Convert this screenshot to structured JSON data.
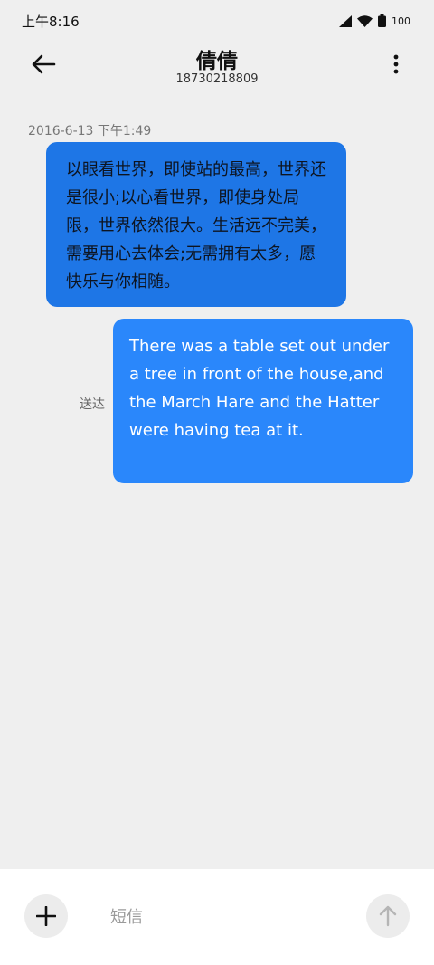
{
  "status_bar": {
    "time": "上午8:16",
    "battery": "100"
  },
  "header": {
    "contact_name": "倩倩",
    "contact_number": "18730218809"
  },
  "conversation": {
    "timestamp": "2016-6-13 下午1:49",
    "messages": [
      {
        "text": "以眼看世界，即使站的最高，世界还是很小;以心看世界，即使身处局限，世界依然很大。生活远不完美，需要用心去体会;无需拥有太多，愿快乐与你相随。"
      },
      {
        "text": "There was a table set out under a tree in front of the house,and the March Hare and the Hatter were having tea at it.",
        "status": "送达"
      }
    ]
  },
  "input_bar": {
    "placeholder": "短信"
  },
  "icons": {
    "back": "arrow-left-icon",
    "more": "more-vertical-icon",
    "add": "plus-icon",
    "send": "arrow-up-icon"
  }
}
